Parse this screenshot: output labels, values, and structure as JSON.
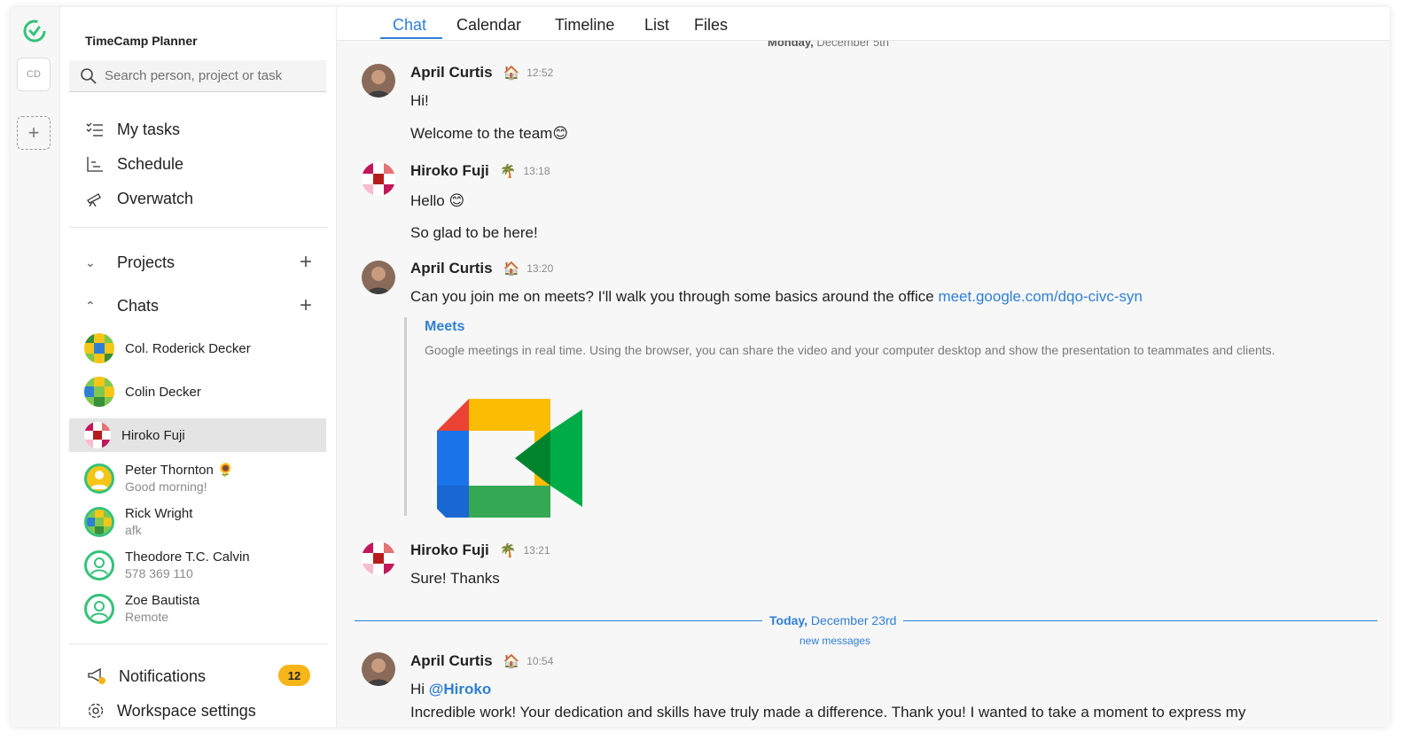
{
  "rail": {
    "workspace_initials": "CD"
  },
  "sidebar": {
    "app_title": "TimeCamp Planner",
    "search_placeholder": "Search person, project or task",
    "nav": [
      {
        "label": "My tasks",
        "icon": "checklist-icon"
      },
      {
        "label": "Schedule",
        "icon": "schedule-icon"
      },
      {
        "label": "Overwatch",
        "icon": "telescope-icon"
      }
    ],
    "projects_label": "Projects",
    "chats_label": "Chats",
    "chats": [
      {
        "name": "Col. Roderick Decker",
        "sub": ""
      },
      {
        "name": "Colin Decker",
        "sub": ""
      },
      {
        "name": "Hiroko Fuji",
        "sub": ""
      },
      {
        "name": "Peter Thornton 🌻",
        "sub": "Good morning!"
      },
      {
        "name": "Rick Wright",
        "sub": "afk"
      },
      {
        "name": "Theodore T.C. Calvin",
        "sub": "578 369 110"
      },
      {
        "name": "Zoe Bautista",
        "sub": "Remote"
      }
    ],
    "notifications_label": "Notifications",
    "notifications_count": "12",
    "settings_label": "Workspace settings"
  },
  "tabs": [
    "Chat",
    "Calendar",
    "Timeline",
    "List",
    "Files"
  ],
  "chat": {
    "date_top_day": "Monday,",
    "date_top_rest": " December 5th",
    "messages": [
      {
        "name": "April Curtis",
        "icon": "🏠",
        "time": "12:52",
        "lines": [
          "Hi!",
          "Welcome to the team😊"
        ]
      },
      {
        "name": "Hiroko Fuji",
        "icon": "🌴",
        "time": "13:18",
        "lines": [
          "Hello 😊",
          "So glad to be here!"
        ]
      },
      {
        "name": "April Curtis",
        "icon": "🏠",
        "time": "13:20",
        "text": "Can you join me on meets? I'll walk you through some basics around the office ",
        "link": "meet.google.com/dqo-civc-syn"
      },
      {
        "name": "Hiroko Fuji",
        "icon": "🌴",
        "time": "13:21",
        "lines": [
          "Sure! Thanks"
        ]
      },
      {
        "name": "April Curtis",
        "icon": "🏠",
        "time": "10:54",
        "greeting": "Hi ",
        "mention": "@Hiroko",
        "line2": "Incredible work! Your dedication and skills have truly made a difference. Thank you! I wanted to take a moment to express my"
      }
    ],
    "preview": {
      "title": "Meets",
      "description": "Google meetings in real time. Using the browser, you can share the video and your computer desktop and show the presentation to teammates and clients."
    },
    "today_bold": "Today,",
    "today_rest": " December 23rd",
    "new_messages": "new messages"
  }
}
